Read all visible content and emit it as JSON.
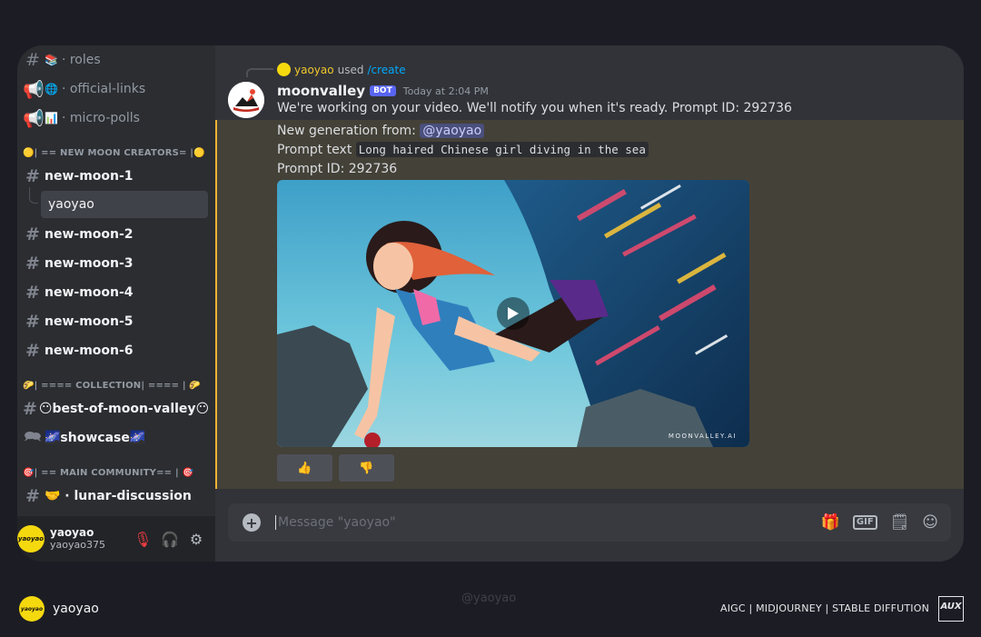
{
  "sidebar": {
    "channels_top": [
      {
        "emoji": "📚",
        "label": "· roles"
      },
      {
        "emoji": "🌐",
        "label": "· official-links"
      },
      {
        "emoji": "📊",
        "label": "· micro-polls"
      }
    ],
    "category_new_moon": "🟡| == NEW MOON CREATORS= |🟡",
    "new_moon_1": "new-moon-1",
    "thread": "yaoyao",
    "new_moon_more": [
      "new-moon-2",
      "new-moon-3",
      "new-moon-4",
      "new-moon-5",
      "new-moon-6"
    ],
    "category_collection": "🌮| ==== COLLECTION| ==== | 🌮",
    "best_of": "😶best-of-moon-valley😶",
    "showcase": "🌌showcase🌌",
    "category_main": "🎯| == MAIN COMMUNITY== | 🎯",
    "lunar": "🤝 · lunar-discussion"
  },
  "user": {
    "name": "yaoyao",
    "tag": "yaoyao375",
    "avatar_text": "yaoyao"
  },
  "message": {
    "reply_user": "yaoyao",
    "reply_used": "used",
    "reply_command": "/create",
    "bot_name": "moonvalley",
    "bot_badge": "BOT",
    "timestamp": "Today at 2:04 PM",
    "text1": "We're working on your video. We'll notify you when it's ready. Prompt ID: 292736",
    "gen_label": "New generation from:",
    "gen_mention": "@yaoyao",
    "prompt_label": "Prompt text",
    "prompt_code": "Long haired Chinese girl diving in the sea",
    "prompt_id_line": "Prompt ID: 292736",
    "video_watermark": "MOONVALLEY.AI",
    "reaction_up": "👍",
    "reaction_down": "👎"
  },
  "composer": {
    "placeholder": "Message \"yaoyao\""
  },
  "footer": {
    "name": "yaoyao",
    "watermark": "@yaoyao",
    "tags": "AIGC | MIDJOURNEY | STABLE DIFFUTION",
    "logo": "AUX"
  },
  "colors": {
    "accent": "#f0b232",
    "brand": "#5865f2",
    "mention": "#c9cdfb",
    "link": "#00a8fc"
  }
}
